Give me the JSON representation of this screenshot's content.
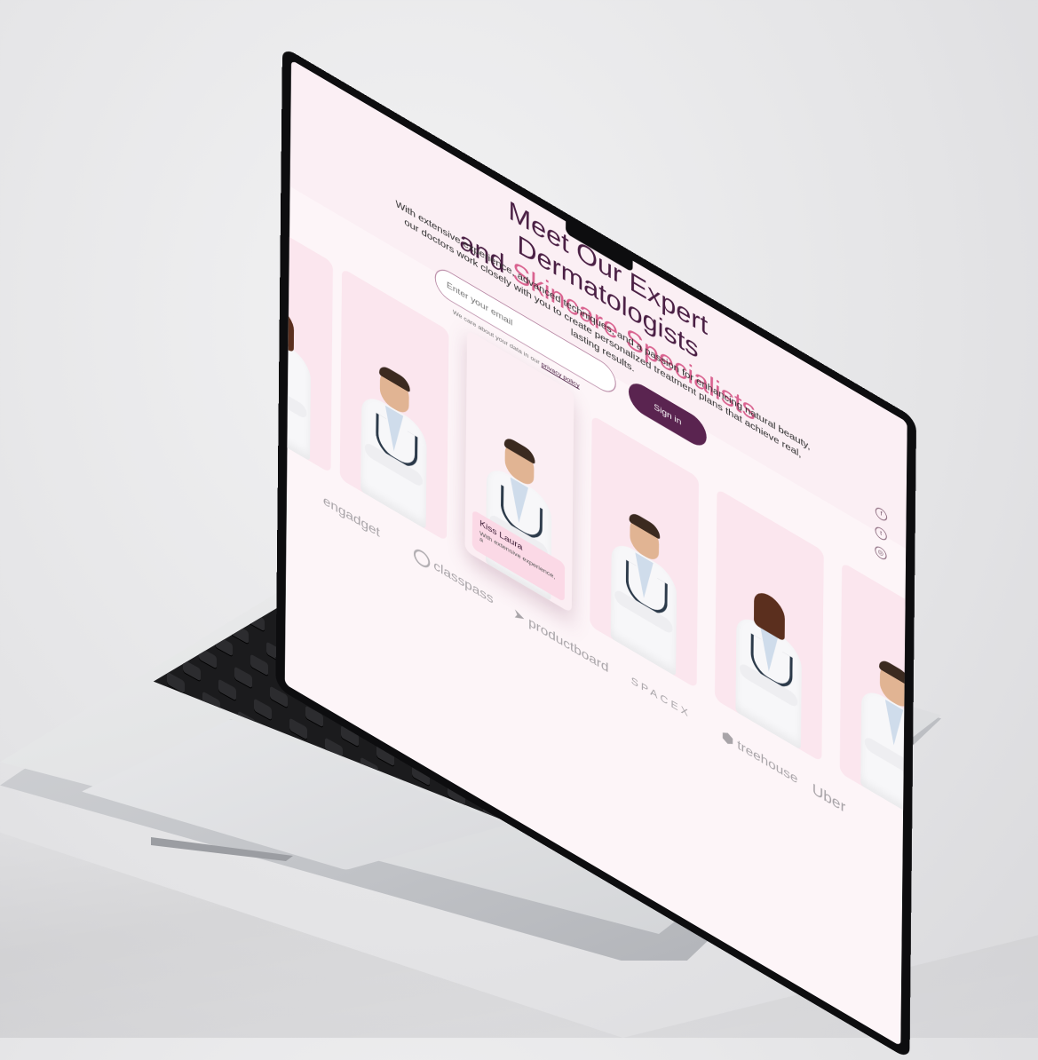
{
  "hero": {
    "headline_line1": "Meet Our Expert Dermatologists",
    "headline_prefix": "and ",
    "headline_highlight": "Skincare Specialists",
    "lead": "With extensive experience, advanced techniques, and a passion for enhancing natural beauty, our doctors work closely with you to create personalized treatment plans that achieve real, lasting results.",
    "email_placeholder": "Enter your email",
    "privacy_text": "We care about your data in our ",
    "privacy_link": "privacy policy",
    "signin_label": "Sign in"
  },
  "social": [
    "f",
    "t",
    "◎"
  ],
  "featured_card": {
    "name": "Kiss Laura",
    "description": "With extensive experience, a"
  },
  "logos": [
    "engadget",
    "classpass",
    "productboard",
    "SPACEX",
    "treehouse",
    "Uber"
  ],
  "colors": {
    "accent": "#d9628f",
    "brand_dark": "#4a1f44",
    "button": "#5a2450",
    "card_bg": "#fbe6ee"
  }
}
